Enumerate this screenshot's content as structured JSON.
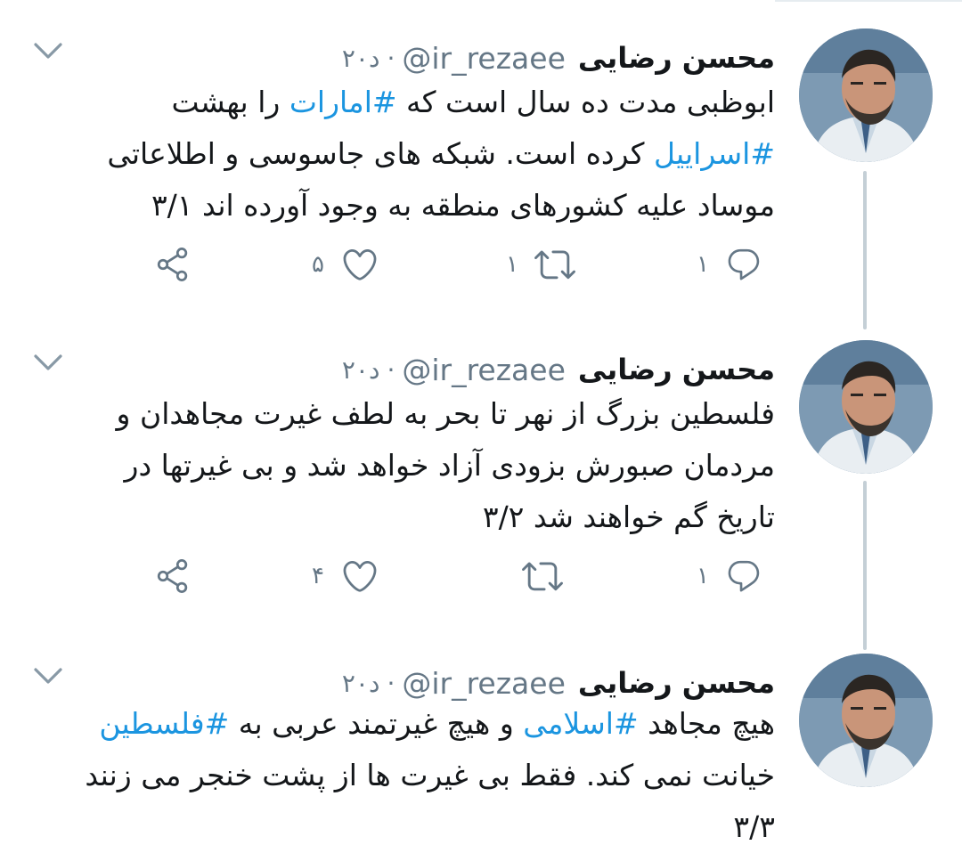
{
  "theme": {
    "link_color": "#1b95e0",
    "icon_color": "#657786",
    "thread_line_color": "#c4cfd6"
  },
  "tweets": [
    {
      "name": "محسن رضایی",
      "handle": "@ir_rezaee",
      "separator": "·",
      "time": "۲۰د",
      "lines": [
        [
          {
            "t": "ابوظبی مدت ده سال است که "
          },
          {
            "t": "#امارات",
            "tag": true
          },
          {
            "t": " را بهشت"
          }
        ],
        [
          {
            "t": "#اسراییل",
            "tag": true
          },
          {
            "t": " کرده است. شبکه های جاسوسی و اطلاعاتی"
          }
        ],
        [
          {
            "t": "موساد علیه کشورهای منطقه به وجود آورده اند ۳/۱"
          }
        ]
      ],
      "reply_count": "۱",
      "retweet_count": "۱",
      "like_count": "۵",
      "reply_icon": "reply-icon",
      "retweet_icon": "retweet-icon",
      "like_icon": "heart-icon",
      "share_icon": "share-icon"
    },
    {
      "name": "محسن رضایی",
      "handle": "@ir_rezaee",
      "separator": "·",
      "time": "۲۰د",
      "lines": [
        [
          {
            "t": "فلسطین بزرگ از نهر تا بحر به لطف  غیرت مجاهدان و"
          }
        ],
        [
          {
            "t": "مردمان صبورش بزودی آزاد خواهد شد و بی غیرتها در"
          }
        ],
        [
          {
            "t": "تاریخ گم خواهند شد ۳/۲"
          }
        ]
      ],
      "reply_count": "۱",
      "retweet_count": "",
      "like_count": "۴",
      "reply_icon": "reply-icon",
      "retweet_icon": "retweet-icon",
      "like_icon": "heart-icon",
      "share_icon": "share-icon"
    },
    {
      "name": "محسن رضایی",
      "handle": "@ir_rezaee",
      "separator": "·",
      "time": "۲۰د",
      "lines": [
        [
          {
            "t": "هیچ مجاهد "
          },
          {
            "t": "#اسلامی",
            "tag": true
          },
          {
            "t": " و هیچ غیرتمند عربی به  "
          },
          {
            "t": "#فلسطین",
            "tag": true
          }
        ],
        [
          {
            "t": "خیانت نمی کند. فقط بی غیرت ها از پشت خنجر می زنند"
          }
        ],
        [
          {
            "t": "۳/۳"
          }
        ]
      ]
    }
  ]
}
